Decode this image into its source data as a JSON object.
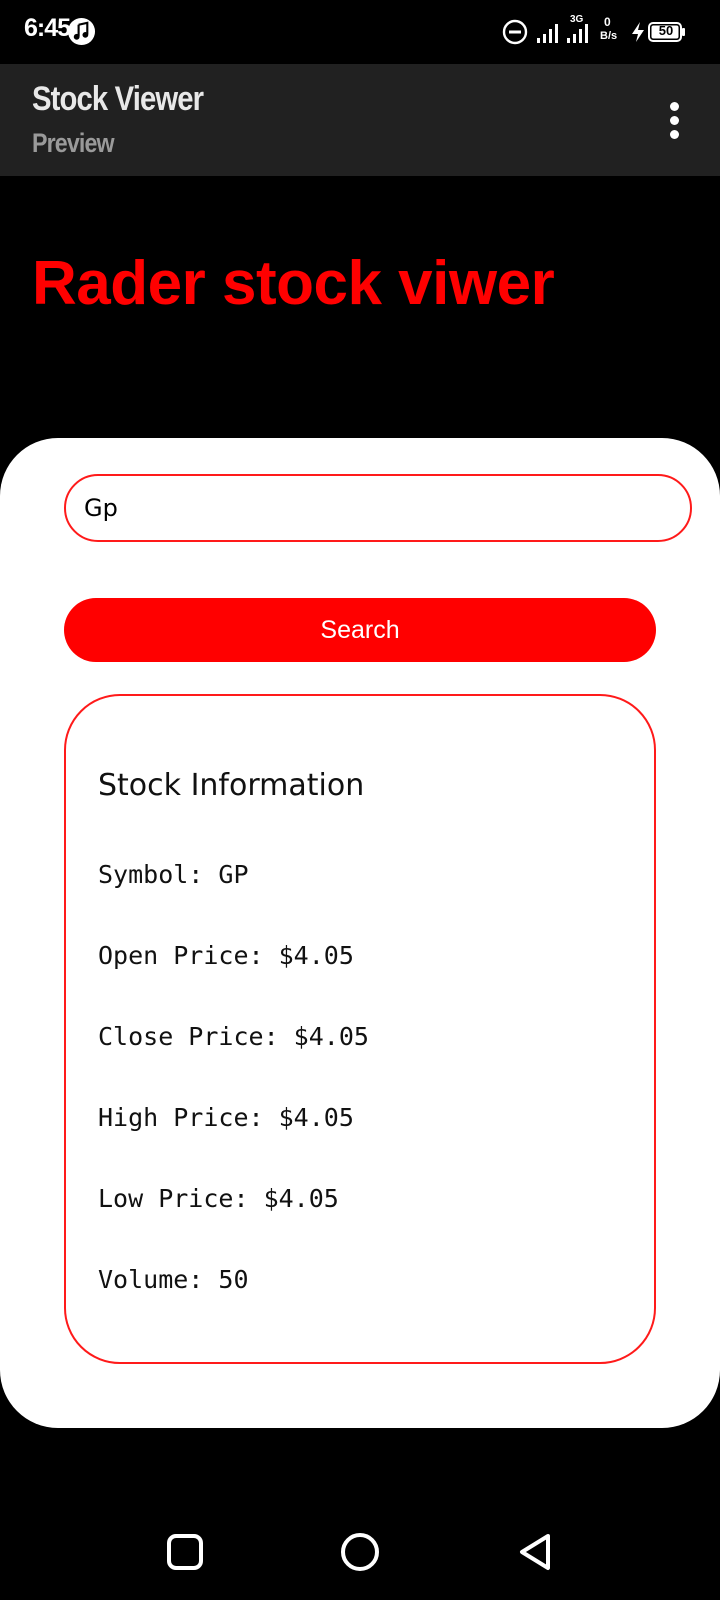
{
  "status_bar": {
    "time": "6:45",
    "network_type": "3G",
    "data_rate_value": "0",
    "data_rate_unit": "B/s",
    "battery_level": "50"
  },
  "app_bar": {
    "title": "Stock Viewer",
    "subtitle": "Preview"
  },
  "headline": "Rader stock viwer",
  "search": {
    "value": "Gp",
    "button_label": "Search"
  },
  "stock_info": {
    "title": "Stock Information",
    "symbol": "Symbol: GP",
    "open_price": "Open Price: $4.05",
    "close_price": "Close Price: $4.05",
    "high_price": "High Price: $4.05",
    "low_price": "Low Price: $4.05",
    "volume": "Volume: 50"
  },
  "icons": {
    "status": [
      "music-icon",
      "do-not-disturb-icon",
      "signal-icon",
      "signal-3g-icon",
      "charging-icon",
      "battery-icon"
    ],
    "app_bar": [
      "overflow-menu-icon"
    ],
    "navigation": [
      "recents-icon",
      "home-icon",
      "back-icon"
    ]
  },
  "colors": {
    "accent": "#ff0000",
    "background": "#000000",
    "app_bar": "#212121",
    "card": "#ffffff"
  }
}
